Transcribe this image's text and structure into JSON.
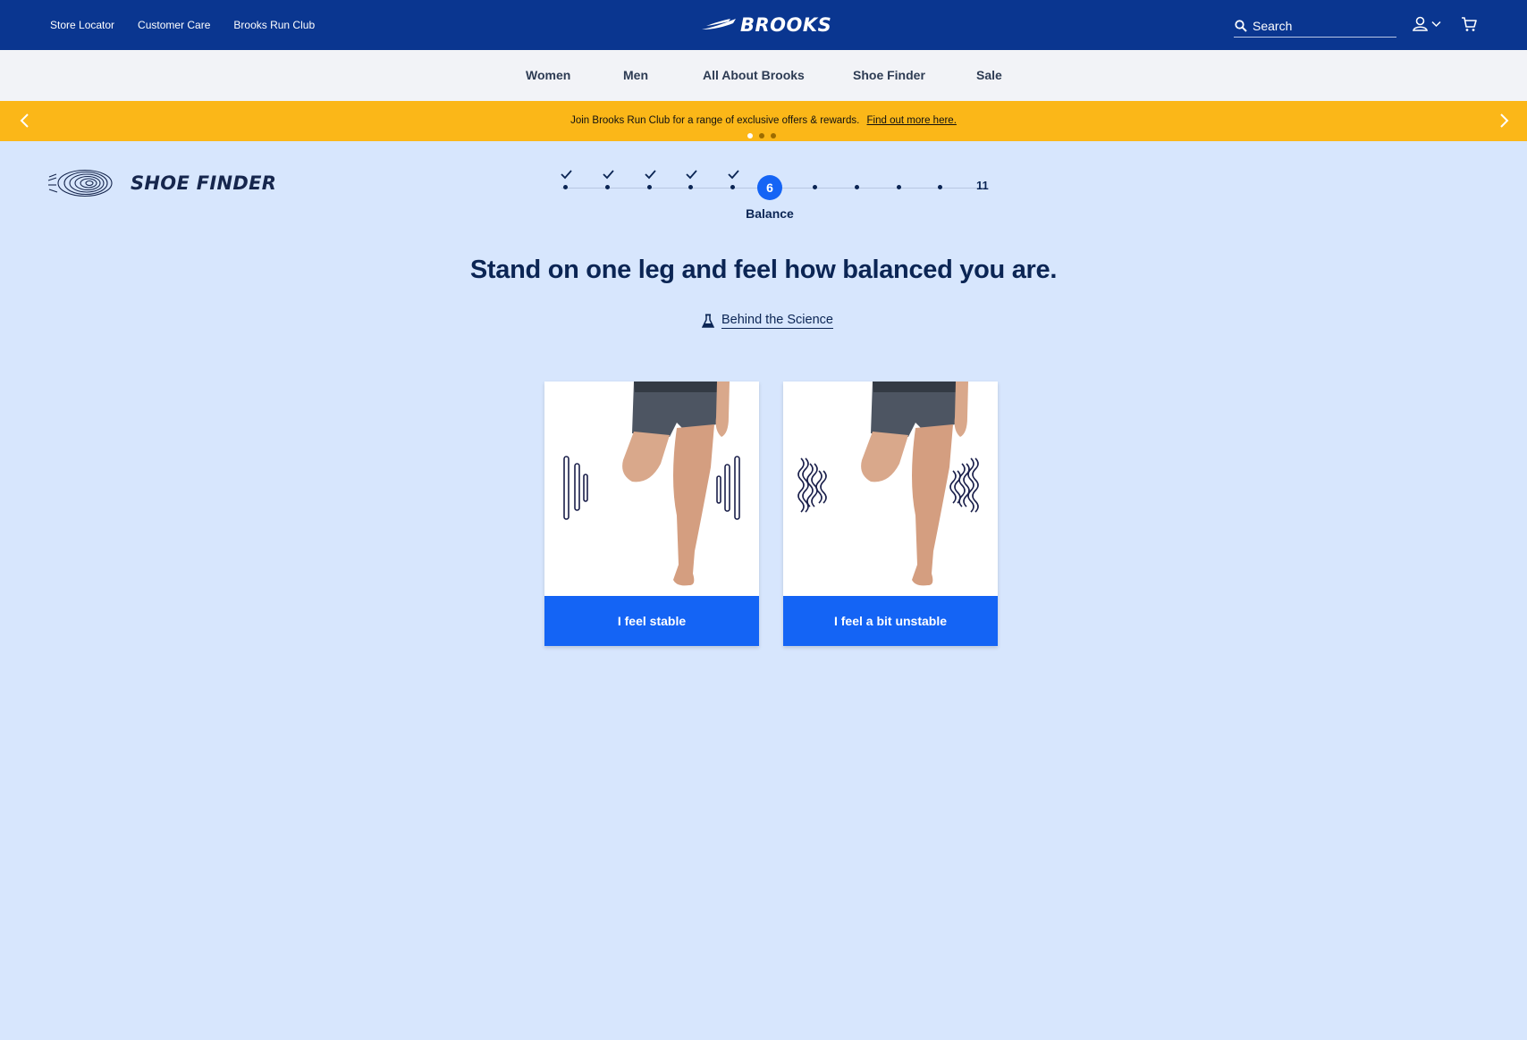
{
  "header": {
    "utility_links": [
      "Store Locator",
      "Customer Care",
      "Brooks Run Club"
    ],
    "logo_text": "BROOKS",
    "search_placeholder": "Search"
  },
  "nav": {
    "items": [
      "Women",
      "Men",
      "All About Brooks",
      "Shoe Finder",
      "Sale"
    ]
  },
  "promo": {
    "text": "Join Brooks Run Club for a range of exclusive offers & rewards.",
    "link": "Find out more here.",
    "slide_count": 3,
    "active_slide": 1
  },
  "finder": {
    "logo_text": "SHOE FINDER",
    "current_step": "6",
    "total_steps": "11",
    "completed_steps": 5,
    "step_label": "Balance",
    "question": "Stand on one leg and feel how balanced you are.",
    "science_link": "Behind the Science"
  },
  "options": [
    {
      "label": "I feel stable",
      "illustration": "straight-lines"
    },
    {
      "label": "I feel a bit unstable",
      "illustration": "wavy-lines"
    }
  ],
  "colors": {
    "header_bg": "#0a3690",
    "promo_bg": "#fbb718",
    "page_bg": "#d7e6fd",
    "accent_blue": "#1464f5",
    "text_navy": "#0b2554"
  }
}
